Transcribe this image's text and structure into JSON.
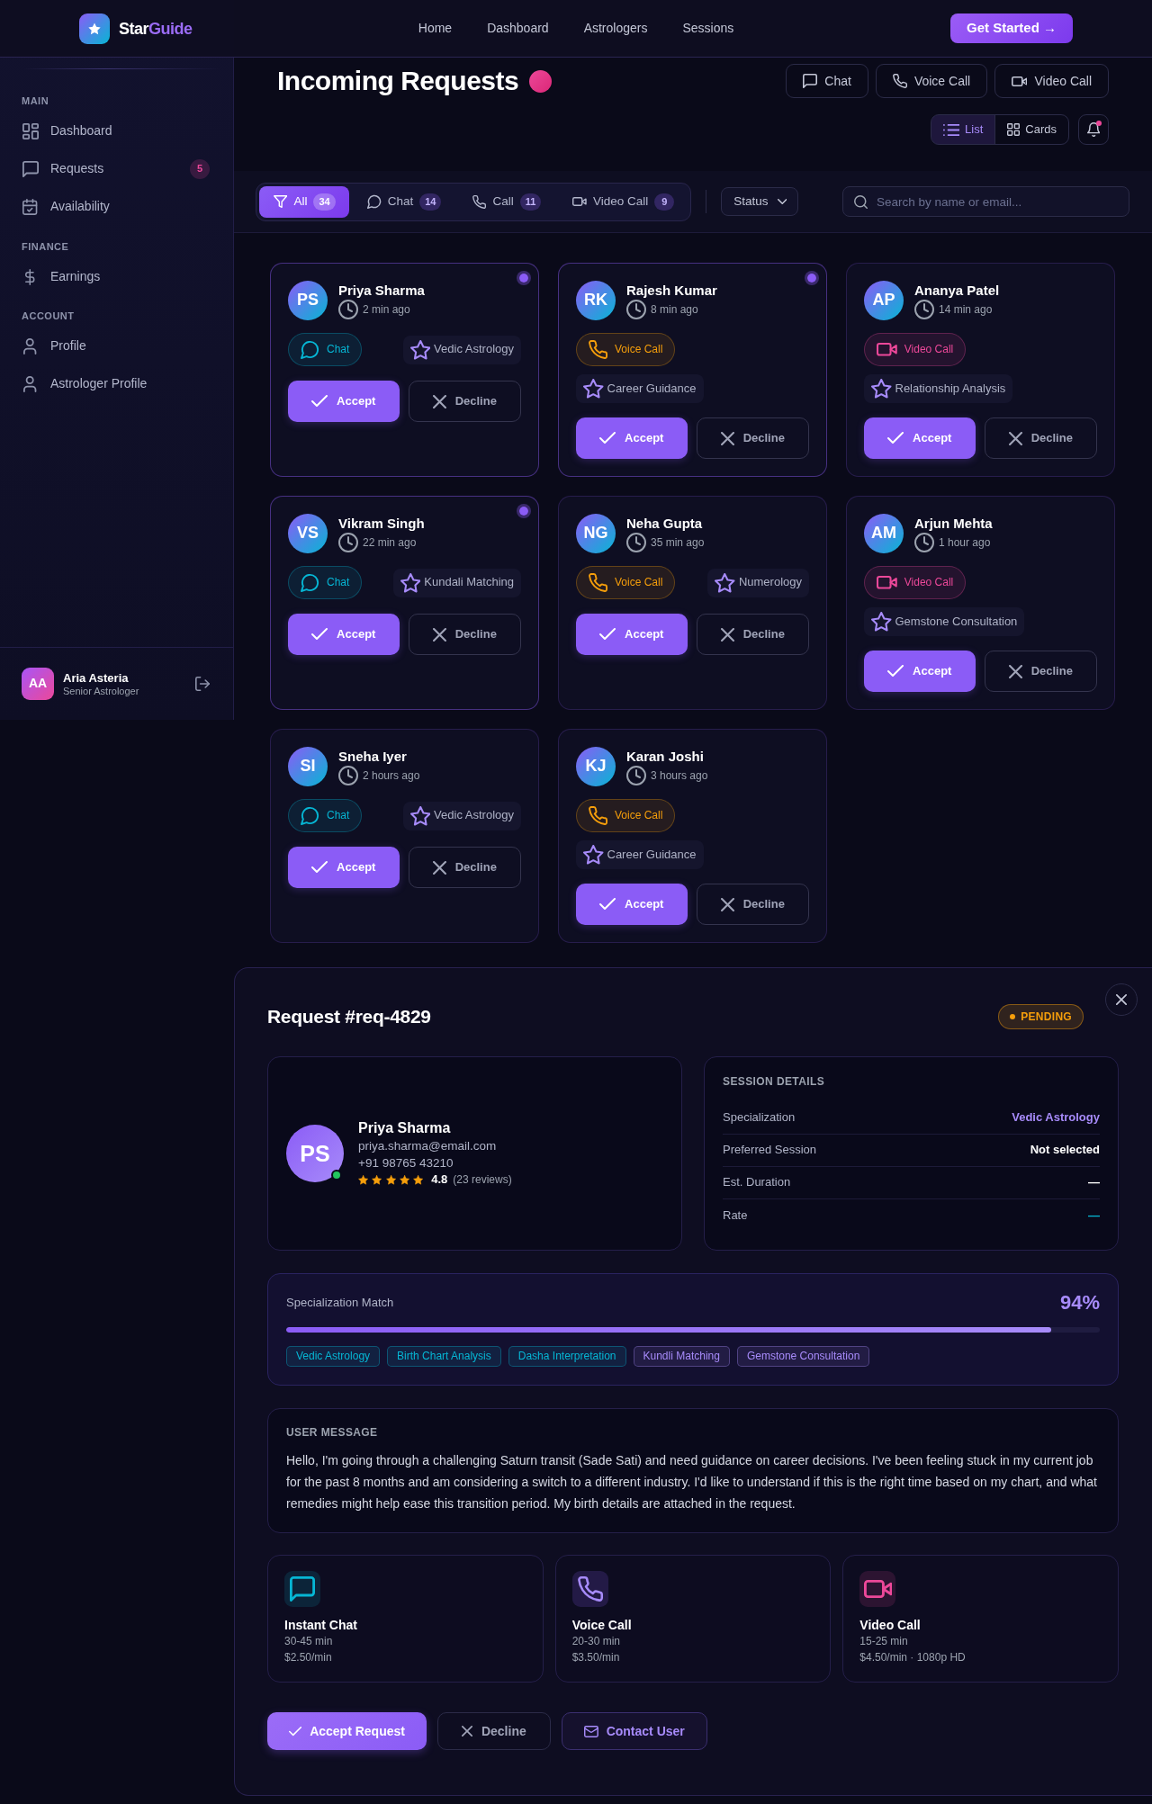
{
  "navbar": {
    "brand": {
      "text": "Star",
      "accent": "Guide"
    },
    "links": [
      "Home",
      "Dashboard",
      "Astrologers",
      "Sessions"
    ],
    "cta": "Get Started →"
  },
  "sidebar": {
    "sections": [
      {
        "title": "MAIN",
        "items": [
          {
            "label": "Dashboard"
          },
          {
            "label": "Requests",
            "badge": "5"
          },
          {
            "label": "Availability"
          }
        ]
      },
      {
        "title": "FINANCE",
        "items": [
          {
            "label": "Earnings"
          }
        ]
      },
      {
        "title": "ACCOUNT",
        "items": [
          {
            "label": "Profile"
          },
          {
            "label": "Astrologer Profile"
          }
        ]
      }
    ],
    "user": {
      "initials": "AA",
      "name": "Aria Asteria",
      "role": "Senior Astrologer"
    }
  },
  "header": {
    "title": "Incoming Requests",
    "buttons": [
      {
        "kind": "chat",
        "label": "Chat"
      },
      {
        "kind": "voice",
        "label": "Voice Call"
      },
      {
        "kind": "video",
        "label": "Video Call"
      }
    ],
    "views": [
      {
        "label": "List",
        "selected": true
      },
      {
        "label": "Cards",
        "selected": false
      }
    ],
    "notifications": {
      "unread": true
    }
  },
  "filters": {
    "tabs": [
      {
        "kind": "all",
        "label": "All",
        "count": "34",
        "selected": true
      },
      {
        "kind": "chat",
        "label": "Chat",
        "count": "14",
        "selected": false
      },
      {
        "kind": "call",
        "label": "Call",
        "count": "11",
        "selected": false
      },
      {
        "kind": "video",
        "label": "Video Call",
        "count": "9",
        "selected": false
      }
    ],
    "status": "Status",
    "search": {
      "placeholder": "Search by name or email..."
    }
  },
  "requests": [
    {
      "initials": "PS",
      "name": "Priya Sharma",
      "time": "2 min ago",
      "kind": "chat",
      "session": "Chat",
      "specialty": "Vedic Astrology",
      "unread": true,
      "accept": "Accept",
      "decline": "Decline"
    },
    {
      "initials": "RK",
      "name": "Rajesh Kumar",
      "time": "8 min ago",
      "kind": "voice",
      "session": "Voice Call",
      "specialty": "Career Guidance",
      "unread": true,
      "accept": "Accept",
      "decline": "Decline"
    },
    {
      "initials": "AP",
      "name": "Ananya Patel",
      "time": "14 min ago",
      "kind": "video",
      "session": "Video Call",
      "specialty": "Relationship Analysis",
      "unread": false,
      "accept": "Accept",
      "decline": "Decline"
    },
    {
      "initials": "VS",
      "name": "Vikram Singh",
      "time": "22 min ago",
      "kind": "chat",
      "session": "Chat",
      "specialty": "Kundali Matching",
      "unread": true,
      "accept": "Accept",
      "decline": "Decline"
    },
    {
      "initials": "NG",
      "name": "Neha Gupta",
      "time": "35 min ago",
      "kind": "voice",
      "session": "Voice Call",
      "specialty": "Numerology",
      "unread": false,
      "accept": "Accept",
      "decline": "Decline"
    },
    {
      "initials": "AM",
      "name": "Arjun Mehta",
      "time": "1 hour ago",
      "kind": "video",
      "session": "Video Call",
      "specialty": "Gemstone Consultation",
      "unread": false,
      "accept": "Accept",
      "decline": "Decline"
    },
    {
      "initials": "SI",
      "name": "Sneha Iyer",
      "time": "2 hours ago",
      "kind": "chat",
      "session": "Chat",
      "specialty": "Vedic Astrology",
      "unread": false,
      "accept": "Accept",
      "decline": "Decline"
    },
    {
      "initials": "KJ",
      "name": "Karan Joshi",
      "time": "3 hours ago",
      "kind": "voice",
      "session": "Voice Call",
      "specialty": "Career Guidance",
      "unread": false,
      "accept": "Accept",
      "decline": "Decline"
    }
  ],
  "modal": {
    "title": "Request #req-4829",
    "status": "PENDING",
    "user": {
      "initials": "PS",
      "online": true,
      "name": "Priya Sharma",
      "email": "priya.sharma@email.com",
      "phone": "+91 98765 43210",
      "stars": 5,
      "rating": "4.8",
      "reviews": "(23 reviews)"
    },
    "session_details": {
      "title": "SESSION DETAILS",
      "rows": [
        {
          "label": "Specialization",
          "value": "Vedic Astrology",
          "color": "#a78bfa"
        },
        {
          "label": "Preferred Session",
          "value": "Not selected",
          "color": "#ffffff"
        },
        {
          "label": "Est. Duration",
          "value": "—",
          "color": "#ffffff"
        },
        {
          "label": "Rate",
          "value": "—",
          "color": "#06b6d4"
        }
      ]
    },
    "match": {
      "label": "Specialization Match",
      "reading": "94%",
      "level": 0.94,
      "tags": [
        {
          "text": "Vedic Astrology",
          "color": "#06b6d4"
        },
        {
          "text": "Birth Chart Analysis",
          "color": "#06b6d4"
        },
        {
          "text": "Dasha Interpretation",
          "color": "#06b6d4"
        },
        {
          "text": "Kundli Matching",
          "color": "#a78bfa"
        },
        {
          "text": "Gemstone Consultation",
          "color": "#a78bfa"
        }
      ]
    },
    "message": {
      "title": "USER MESSAGE",
      "text": "Hello, I'm going through a challenging Saturn transit (Sade Sati) and need guidance on career decisions. I've been feeling stuck in my current job for the past 8 months and am considering a switch to a different industry. I'd like to understand if this is the right time based on my chart, and what remedies might help ease this transition period. My birth details are attached in the request."
    },
    "options": [
      {
        "kind": "chat",
        "title": "Instant Chat",
        "duration": "30-45 min",
        "rate": "$2.50/min"
      },
      {
        "kind": "voice",
        "title": "Voice Call",
        "duration": "20-30 min",
        "rate": "$3.50/min"
      },
      {
        "kind": "video",
        "title": "Video Call",
        "duration": "15-25 min",
        "rate": "$4.50/min · 1080p HD"
      }
    ],
    "actions": [
      {
        "kind": "accept",
        "label": "Accept Request"
      },
      {
        "kind": "decline",
        "label": "Decline"
      },
      {
        "kind": "contact",
        "label": "Contact User"
      }
    ]
  }
}
